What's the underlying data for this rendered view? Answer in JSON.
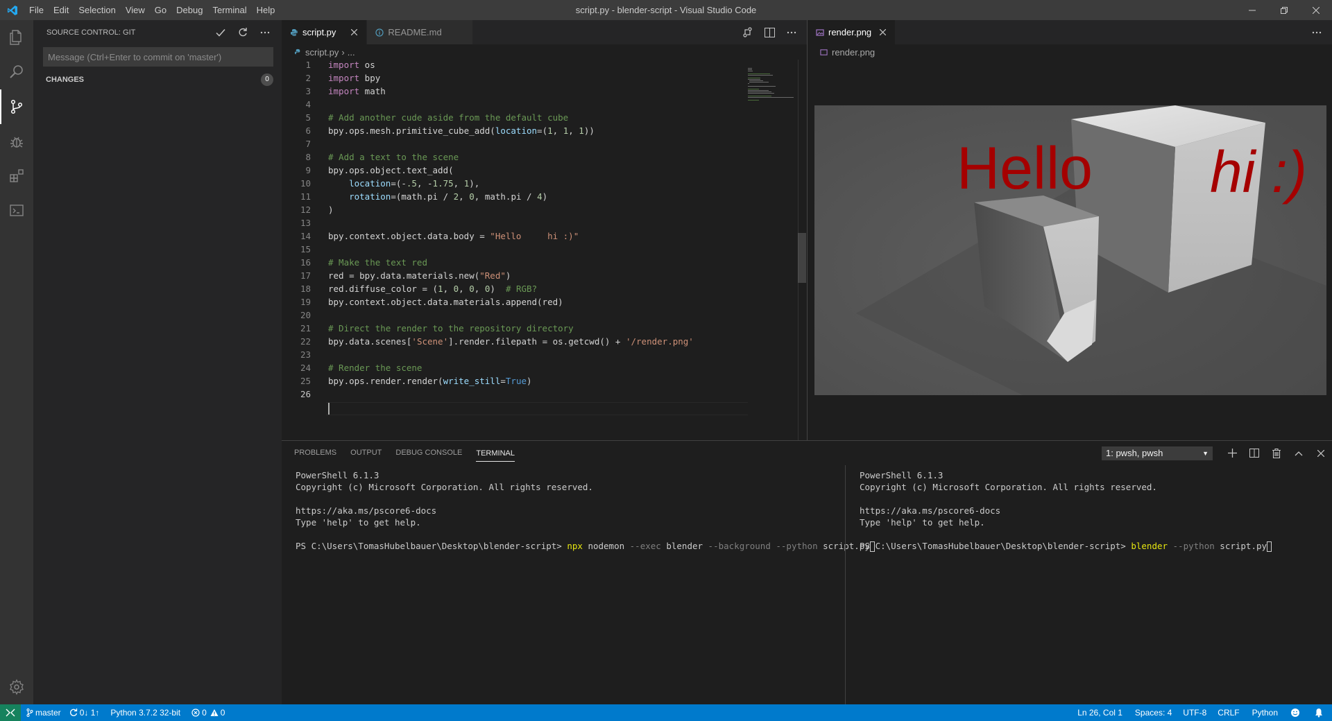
{
  "window": {
    "title": "script.py - blender-script - Visual Studio Code"
  },
  "menu": [
    "File",
    "Edit",
    "Selection",
    "View",
    "Go",
    "Debug",
    "Terminal",
    "Help"
  ],
  "activity": {
    "icons": [
      "files-icon",
      "search-icon",
      "source-control-icon",
      "debug-icon",
      "extensions-icon",
      "remote-explorer-icon"
    ],
    "settings_icon": "gear-icon"
  },
  "sidebar": {
    "title": "SOURCE CONTROL: GIT",
    "commit_placeholder": "Message (Ctrl+Enter to commit on 'master')",
    "changes_label": "CHANGES",
    "changes_count": "0"
  },
  "editor1": {
    "tabs": [
      {
        "label": "script.py",
        "active": true
      },
      {
        "label": "README.md",
        "active": false
      }
    ],
    "breadcrumb": {
      "file": "script.py",
      "rest": "..."
    },
    "current_line": 26
  },
  "editor2": {
    "tab": "render.png",
    "breadcrumb": "render.png",
    "render_text_left": "Hello",
    "render_text_right": "hi :)"
  },
  "panel": {
    "tabs": [
      "PROBLEMS",
      "OUTPUT",
      "DEBUG CONSOLE",
      "TERMINAL"
    ],
    "active_tab": "TERMINAL",
    "terminal_select": "1: pwsh, pwsh",
    "left": {
      "lines": [
        "PowerShell 6.1.3",
        "Copyright (c) Microsoft Corporation. All rights reserved.",
        "",
        "https://aka.ms/pscore6-docs",
        "Type 'help' to get help.",
        ""
      ],
      "prompt": "PS C:\\Users\\TomasHubelbauer\\Desktop\\blender-script> ",
      "cmd": "npx",
      "arg1": " nodemon ",
      "flag1": "--exec",
      "arg2": " blender ",
      "flag2": "--background",
      "flag3": " --python",
      "arg3": " script.py"
    },
    "right": {
      "lines": [
        "PowerShell 6.1.3",
        "Copyright (c) Microsoft Corporation. All rights reserved.",
        "",
        "https://aka.ms/pscore6-docs",
        "Type 'help' to get help.",
        ""
      ],
      "prompt": "PS C:\\Users\\TomasHubelbauer\\Desktop\\blender-script> ",
      "cmd": "blender",
      "flag1": " --python",
      "arg1": " script.py"
    }
  },
  "status": {
    "branch": "master",
    "sync": "0↓ 1↑",
    "interpreter": "Python 3.7.2 32-bit",
    "errors": "0",
    "warnings": "0",
    "position": "Ln 26, Col 1",
    "spaces": "Spaces: 4",
    "encoding": "UTF-8",
    "eol": "CRLF",
    "language": "Python"
  },
  "colors": {
    "statusbar": "#007acc",
    "remote": "#16825d",
    "render_text": "#a50000"
  }
}
